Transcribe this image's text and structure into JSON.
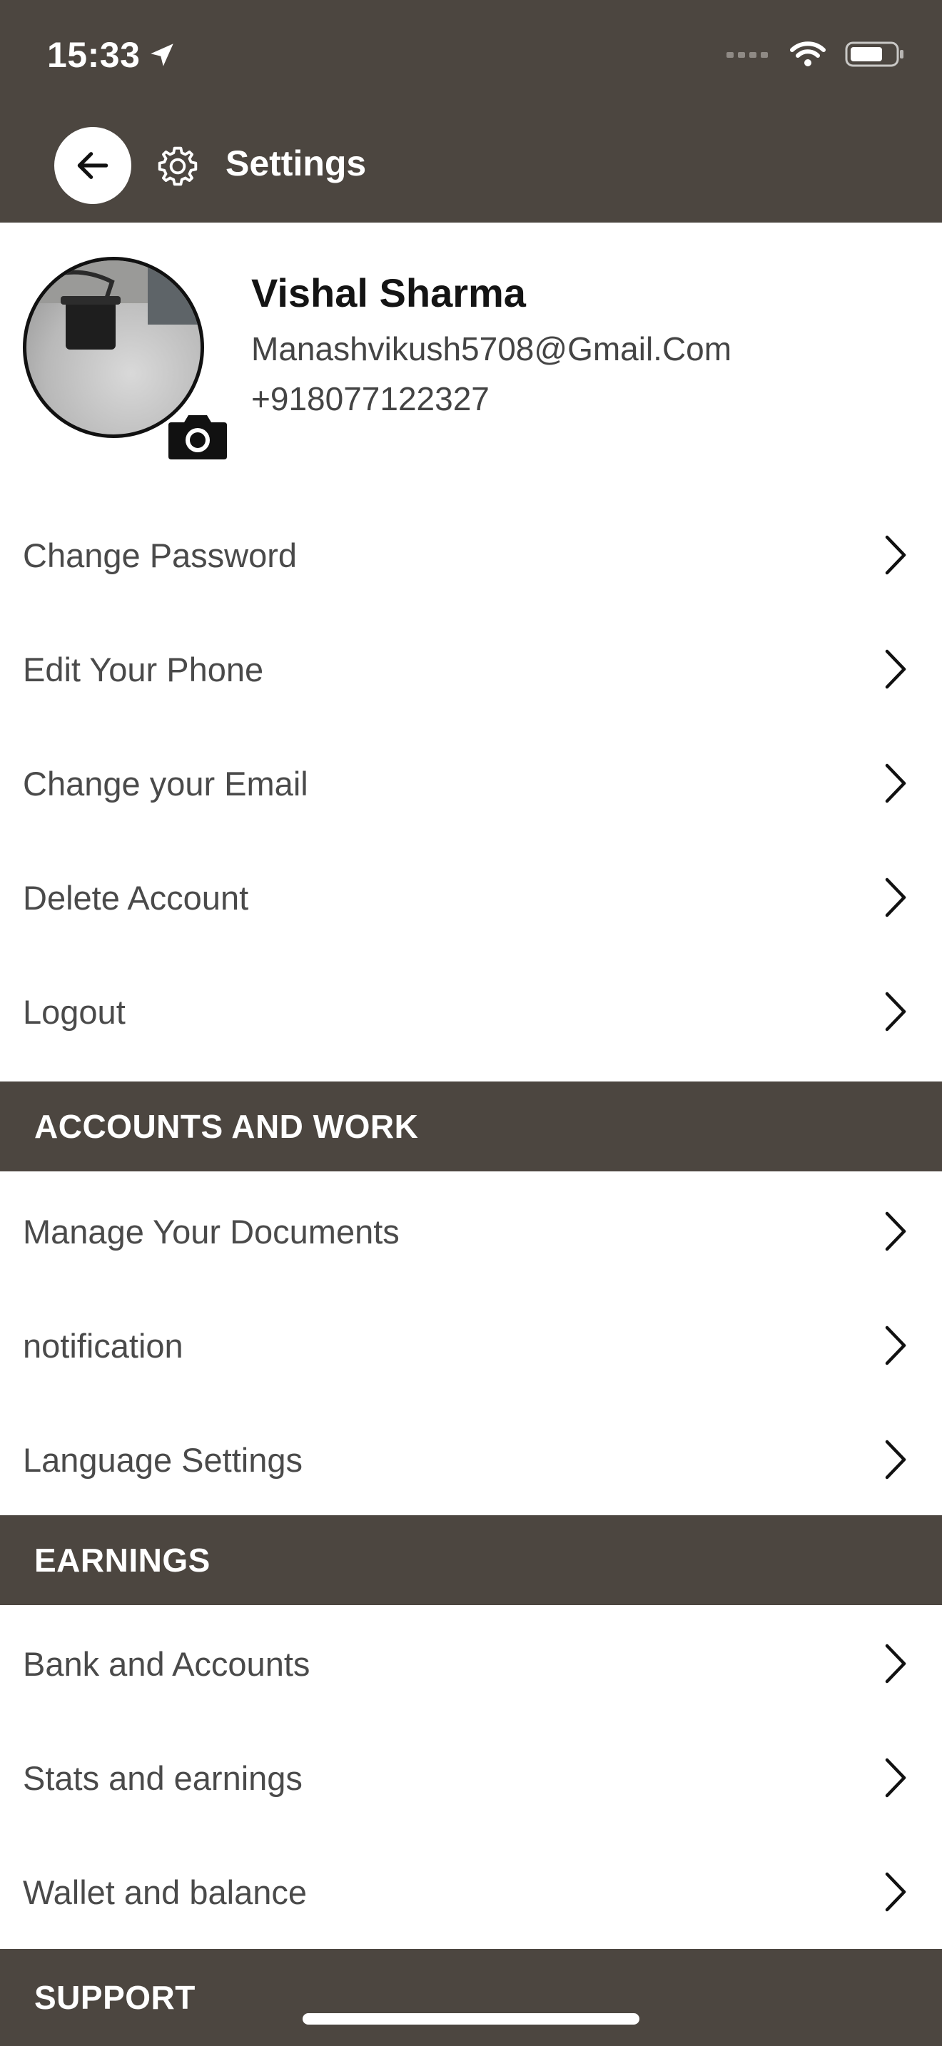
{
  "status_bar": {
    "time": "15:33"
  },
  "header": {
    "title": "Settings"
  },
  "profile": {
    "name": "Vishal Sharma",
    "email": "Manashvikush5708@Gmail.Com",
    "phone": "+918077122327"
  },
  "account_items": [
    {
      "label": "Change Password"
    },
    {
      "label": "Edit Your Phone"
    },
    {
      "label": "Change your Email"
    },
    {
      "label": "Delete Account"
    },
    {
      "label": "Logout"
    }
  ],
  "sections": {
    "accounts_work": {
      "title": "ACCOUNTS AND WORK",
      "items": [
        {
          "label": "Manage Your Documents"
        },
        {
          "label": "notification"
        },
        {
          "label": "Language Settings"
        }
      ]
    },
    "earnings": {
      "title": "EARNINGS",
      "items": [
        {
          "label": "Bank and Accounts"
        },
        {
          "label": "Stats and earnings"
        },
        {
          "label": "Wallet and balance"
        }
      ]
    },
    "support": {
      "title": "SUPPORT"
    }
  },
  "colors": {
    "header_bg": "#4c4640",
    "row_text": "#4a4a4a"
  },
  "icons": [
    "location-arrow-icon",
    "signal-icon",
    "wifi-icon",
    "battery-icon",
    "back-arrow-icon",
    "gear-icon",
    "camera-icon",
    "chevron-right-icon"
  ]
}
